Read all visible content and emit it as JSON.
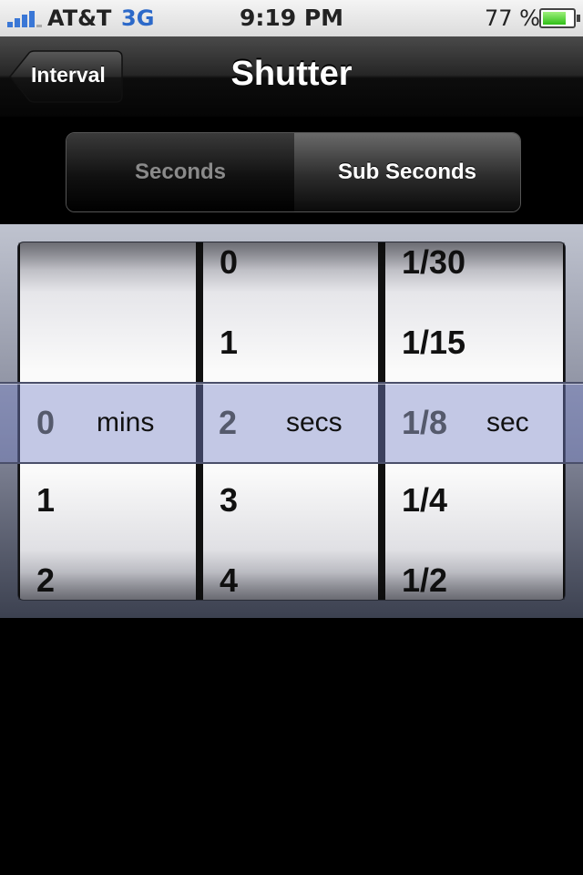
{
  "status_bar": {
    "carrier": "AT&T",
    "network": "3G",
    "time": "9:19 PM",
    "battery_percent": "77 %",
    "battery_level": 0.77,
    "signal_bars": 4
  },
  "nav": {
    "back_label": "Interval",
    "title": "Shutter"
  },
  "segments": {
    "options": [
      "Seconds",
      "Sub Seconds"
    ],
    "selected": "Sub Seconds"
  },
  "picker": {
    "minutes": {
      "above": [
        "",
        ""
      ],
      "selected": "0",
      "unit": "mins",
      "below": [
        "1",
        "2"
      ]
    },
    "seconds": {
      "above": [
        "0",
        "1"
      ],
      "selected": "2",
      "unit": "secs",
      "below": [
        "3",
        "4"
      ]
    },
    "subseconds": {
      "above": [
        "1/30",
        "1/15"
      ],
      "selected": "1/8",
      "unit": "sec",
      "below": [
        "1/4",
        "1/2"
      ]
    }
  },
  "colors": {
    "network_text": "#2c69c9",
    "battery_fill": "#2fbf16",
    "selection_band": "#7882c8"
  }
}
